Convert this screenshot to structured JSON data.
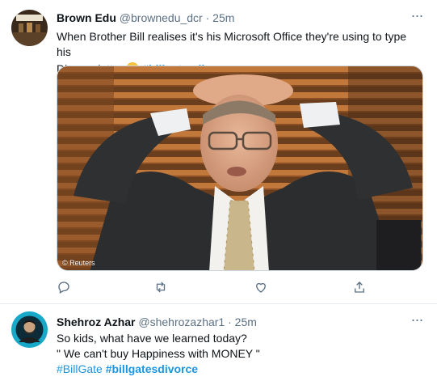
{
  "tweets": [
    {
      "author": "Brown Edu",
      "handle": "@brownedu_dcr",
      "dot": "·",
      "time": "25m",
      "line1": "When Brother Bill realises it's his Microsoft Office they're using to type his",
      "line2_text": "Divorce letter",
      "hashtag": "#billgatesdivorce",
      "emoji": "worried-face",
      "image_credit": "© Reuters",
      "actions": [
        "reply-icon",
        "retweet-icon",
        "like-icon",
        "share-icon"
      ]
    },
    {
      "author": "Shehroz Azhar",
      "handle": "@shehrozazhar1",
      "dot": "·",
      "time": "25m",
      "line1": "So kids, what have we learned today?",
      "line2": "\" We can't buy Happiness with MONEY \"",
      "hashtag1": "#BillGate",
      "hashtag2": "#billgatesdivorce"
    }
  ],
  "colors": {
    "accent": "#1b95e0",
    "secondary_text": "#5b7083",
    "divider": "#e6ecf0"
  }
}
